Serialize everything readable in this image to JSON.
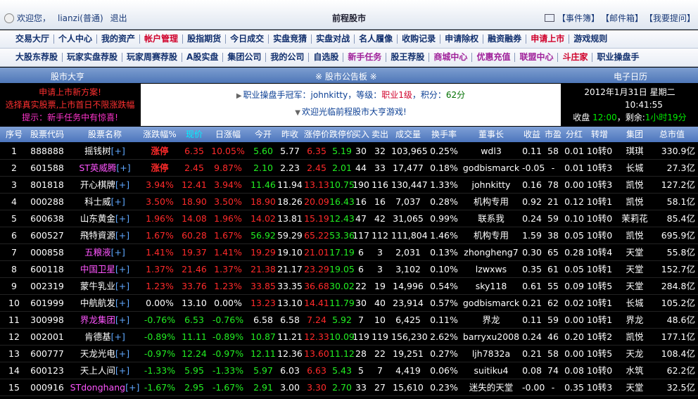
{
  "header": {
    "welcome": "欢迎您，",
    "username": "lianzi(普通)",
    "logout": "退出",
    "site_title": "前程股市",
    "links": [
      "【事件簿】",
      "【邮件箱】",
      "【我要提问】"
    ]
  },
  "nav1": [
    "交易大厅",
    "个人中心",
    "我的资产",
    "帐户管理",
    "股指期货",
    "今日成交",
    "实盘竞猜",
    "实盘对战",
    "名人履像",
    "收购记录",
    "申请除权",
    "融资融券",
    "申请上市",
    "游戏规则"
  ],
  "nav2": [
    "大股东荐股",
    "玩家实盘荐股",
    "玩家周赛荐股",
    "A股实盘",
    "集团公司",
    "我的公司",
    "自选股",
    "新手任务",
    "股王荐股",
    "商城中心",
    "优惠充值",
    "联盟中心",
    "斗庄家",
    "职业操盘手"
  ],
  "sections": {
    "left": "股市大亨",
    "center": "※ 股市公告板 ※",
    "right": "电子日历"
  },
  "left_news": [
    "申请上市新方案!",
    "选择真实股票,上市首日不限涨跌幅",
    "提示：新手任务中有惊喜!"
  ],
  "notice": {
    "champ_label": "职业操盘手冠军：",
    "champ_name": "johnkitty",
    "level_label": "，等级：",
    "level": "职业1级",
    "points_label": "，积分：",
    "points": "62分",
    "welcome": "欢迎光临前程股市大亨游戏!"
  },
  "calendar": {
    "date": "2012年1月31日 星期二",
    "time": "10:41:55",
    "close_label": "收盘",
    "close_time": "12:00",
    "remain_label": "，剩余:",
    "remain": "1小时19分"
  },
  "columns": [
    "序号",
    "股票代码",
    "股票名称",
    "涨跌幅%",
    "现价",
    "日涨幅",
    "今开",
    "昨收",
    "涨停价",
    "跌停价",
    "买入",
    "卖出",
    "成交量",
    "换手率",
    "董事长",
    "收益",
    "市盈",
    "分红",
    "转增",
    "集团",
    "总市值"
  ],
  "plus_mark": "[+]",
  "rows": [
    {
      "no": "1",
      "code": "888888",
      "name": "摇钱树",
      "pct": "涨停",
      "price": "6.35",
      "day": "10.05%",
      "open": "5.60",
      "prev": "5.77",
      "up": "6.35",
      "down": "5.19",
      "buy": "30",
      "sell": "32",
      "vol": "103,965",
      "turn": "0.25%",
      "chair": "wdl3",
      "eps": "0.11",
      "pe": "58",
      "div": "0.01",
      "conv": "10转0",
      "group": "琪琪",
      "cap": "330.9亿",
      "dir": "stop",
      "oc": "g",
      "namec": "w"
    },
    {
      "no": "2",
      "code": "601588",
      "name": "ST英威腾",
      "pct": "涨停",
      "price": "2.45",
      "day": "9.87%",
      "open": "2.10",
      "prev": "2.23",
      "up": "2.45",
      "down": "2.01",
      "buy": "44",
      "sell": "33",
      "vol": "17,477",
      "turn": "0.18%",
      "chair": "godbismarck",
      "eps": "-0.05",
      "pe": "-",
      "div": "0.01",
      "conv": "10转3",
      "group": "长城",
      "cap": "27.3亿",
      "dir": "stop",
      "oc": "g",
      "namec": "m"
    },
    {
      "no": "3",
      "code": "801818",
      "name": "开心棋牌",
      "pct": "3.94%",
      "price": "12.41",
      "day": "3.94%",
      "open": "11.46",
      "prev": "11.94",
      "up": "13.13",
      "down": "10.75",
      "buy": "190",
      "sell": "116",
      "vol": "130,447",
      "turn": "1.33%",
      "chair": "johnkitty",
      "eps": "0.16",
      "pe": "78",
      "div": "0.00",
      "conv": "10转3",
      "group": "凯悦",
      "cap": "127.2亿",
      "dir": "up",
      "oc": "g",
      "namec": "w"
    },
    {
      "no": "4",
      "code": "000288",
      "name": "科士威",
      "pct": "3.50%",
      "price": "18.90",
      "day": "3.50%",
      "open": "18.90",
      "prev": "18.26",
      "up": "20.09",
      "down": "16.43",
      "buy": "16",
      "sell": "16",
      "vol": "7,037",
      "turn": "0.28%",
      "chair": "机构专用",
      "eps": "0.92",
      "pe": "21",
      "div": "0.12",
      "conv": "10转1",
      "group": "凯悦",
      "cap": "58.1亿",
      "dir": "up",
      "oc": "rd",
      "namec": "w"
    },
    {
      "no": "5",
      "code": "600638",
      "name": "山东黄金",
      "pct": "1.96%",
      "price": "14.08",
      "day": "1.96%",
      "open": "14.02",
      "prev": "13.81",
      "up": "15.19",
      "down": "12.43",
      "buy": "47",
      "sell": "42",
      "vol": "31,065",
      "turn": "0.99%",
      "chair": "联系我",
      "eps": "0.24",
      "pe": "59",
      "div": "0.10",
      "conv": "10转0",
      "group": "茉莉花",
      "cap": "85.4亿",
      "dir": "up",
      "oc": "rd",
      "namec": "w"
    },
    {
      "no": "6",
      "code": "600527",
      "name": "飛特資源",
      "pct": "1.67%",
      "price": "60.28",
      "day": "1.67%",
      "open": "56.92",
      "prev": "59.29",
      "up": "65.22",
      "down": "53.36",
      "buy": "117",
      "sell": "112",
      "vol": "111,804",
      "turn": "1.46%",
      "chair": "机构专用",
      "eps": "1.59",
      "pe": "38",
      "div": "0.05",
      "conv": "10转0",
      "group": "凯悦",
      "cap": "695.9亿",
      "dir": "up",
      "oc": "g",
      "namec": "w"
    },
    {
      "no": "7",
      "code": "000858",
      "name": "五粮液",
      "pct": "1.41%",
      "price": "19.37",
      "day": "1.41%",
      "open": "19.29",
      "prev": "19.10",
      "up": "21.01",
      "down": "17.19",
      "buy": "6",
      "sell": "3",
      "vol": "2,031",
      "turn": "0.13%",
      "chair": "zhongheng7",
      "eps": "0.30",
      "pe": "65",
      "div": "0.28",
      "conv": "10转4",
      "group": "天堂",
      "cap": "55.8亿",
      "dir": "up",
      "oc": "rd",
      "namec": "m"
    },
    {
      "no": "8",
      "code": "600118",
      "name": "中国卫星",
      "pct": "1.37%",
      "price": "21.46",
      "day": "1.37%",
      "open": "21.38",
      "prev": "21.17",
      "up": "23.29",
      "down": "19.05",
      "buy": "6",
      "sell": "3",
      "vol": "3,102",
      "turn": "0.10%",
      "chair": "lzwxws",
      "eps": "0.35",
      "pe": "61",
      "div": "0.05",
      "conv": "10转1",
      "group": "天堂",
      "cap": "152.7亿",
      "dir": "up",
      "oc": "rd",
      "namec": "m"
    },
    {
      "no": "9",
      "code": "002319",
      "name": "蒙牛乳业",
      "pct": "1.23%",
      "price": "33.76",
      "day": "1.23%",
      "open": "33.85",
      "prev": "33.35",
      "up": "36.68",
      "down": "30.02",
      "buy": "22",
      "sell": "19",
      "vol": "14,996",
      "turn": "0.54%",
      "chair": "sky118",
      "eps": "0.61",
      "pe": "55",
      "div": "0.09",
      "conv": "10转5",
      "group": "天堂",
      "cap": "284.8亿",
      "dir": "up",
      "oc": "rd",
      "namec": "w"
    },
    {
      "no": "10",
      "code": "601999",
      "name": "中航航发",
      "pct": "0.00%",
      "price": "13.10",
      "day": "0.00%",
      "open": "13.23",
      "prev": "13.10",
      "up": "14.41",
      "down": "11.79",
      "buy": "30",
      "sell": "40",
      "vol": "23,914",
      "turn": "0.57%",
      "chair": "godbismarck",
      "eps": "0.21",
      "pe": "62",
      "div": "0.02",
      "conv": "10转1",
      "group": "长城",
      "cap": "105.2亿",
      "dir": "flat",
      "oc": "rd",
      "namec": "w"
    },
    {
      "no": "11",
      "code": "300998",
      "name": "界龙集团",
      "pct": "-0.76%",
      "price": "6.53",
      "day": "-0.76%",
      "open": "6.58",
      "prev": "6.58",
      "up": "7.24",
      "down": "5.92",
      "buy": "7",
      "sell": "10",
      "vol": "6,425",
      "turn": "0.11%",
      "chair": "界龙",
      "eps": "0.11",
      "pe": "59",
      "div": "0.00",
      "conv": "10转1",
      "group": "界龙",
      "cap": "48.6亿",
      "dir": "down",
      "oc": "w",
      "namec": "m"
    },
    {
      "no": "12",
      "code": "002001",
      "name": "肯德基",
      "pct": "-0.89%",
      "price": "11.11",
      "day": "-0.89%",
      "open": "10.87",
      "prev": "11.21",
      "up": "12.33",
      "down": "10.09",
      "buy": "119",
      "sell": "119",
      "vol": "156,230",
      "turn": "2.62%",
      "chair": "barryxu2008",
      "eps": "0.24",
      "pe": "46",
      "div": "0.20",
      "conv": "10转2",
      "group": "凯悦",
      "cap": "177.1亿",
      "dir": "down",
      "oc": "g",
      "namec": "w"
    },
    {
      "no": "13",
      "code": "600777",
      "name": "天龙光电",
      "pct": "-0.97%",
      "price": "12.24",
      "day": "-0.97%",
      "open": "12.11",
      "prev": "12.36",
      "up": "13.60",
      "down": "11.12",
      "buy": "28",
      "sell": "22",
      "vol": "19,251",
      "turn": "0.27%",
      "chair": "ljh7832a",
      "eps": "0.21",
      "pe": "58",
      "div": "0.00",
      "conv": "10转5",
      "group": "天龙",
      "cap": "108.4亿",
      "dir": "down",
      "oc": "g",
      "namec": "w"
    },
    {
      "no": "14",
      "code": "600123",
      "name": "天上人间",
      "pct": "-1.33%",
      "price": "5.95",
      "day": "-1.33%",
      "open": "5.97",
      "prev": "6.03",
      "up": "6.63",
      "down": "5.43",
      "buy": "5",
      "sell": "7",
      "vol": "4,419",
      "turn": "0.06%",
      "chair": "suitiku4",
      "eps": "0.08",
      "pe": "74",
      "div": "0.08",
      "conv": "10转0",
      "group": "水筑",
      "cap": "62.2亿",
      "dir": "down",
      "oc": "g",
      "namec": "w"
    },
    {
      "no": "15",
      "code": "000916",
      "name": "STdonghang",
      "pct": "-1.67%",
      "price": "2.95",
      "day": "-1.67%",
      "open": "2.91",
      "prev": "3.00",
      "up": "3.30",
      "down": "2.70",
      "buy": "33",
      "sell": "27",
      "vol": "15,610",
      "turn": "0.23%",
      "chair": "迷失的天堂",
      "eps": "-0.00",
      "pe": "-",
      "div": "0.35",
      "conv": "10转3",
      "group": "天堂",
      "cap": "32.5亿",
      "dir": "down",
      "oc": "g",
      "namec": "m"
    }
  ]
}
